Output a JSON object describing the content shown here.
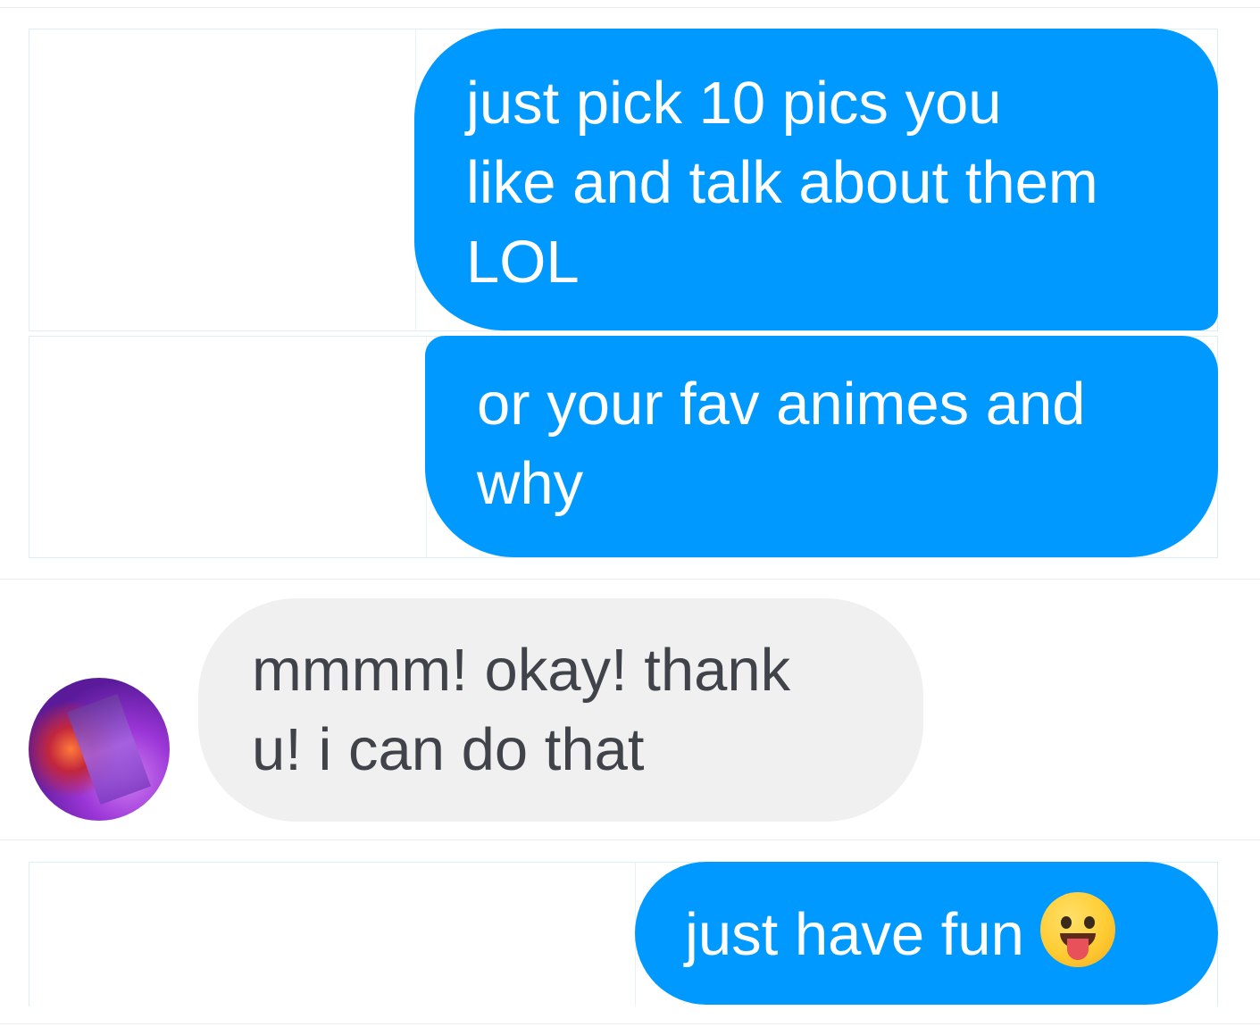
{
  "conversation": {
    "messages": [
      {
        "direction": "outgoing",
        "lines": [
          "just pick 10 pics you",
          "like and talk about them",
          "LOL"
        ]
      },
      {
        "direction": "outgoing",
        "lines": [
          "or your fav animes and",
          "why"
        ]
      },
      {
        "direction": "incoming",
        "lines": [
          "mmmm! okay! thank",
          "u! i can do that"
        ],
        "avatar_icon": "user-avatar"
      },
      {
        "direction": "outgoing",
        "lines": [
          "just have fun"
        ],
        "emoji": "face-with-tongue-icon"
      }
    ]
  },
  "colors": {
    "outgoing_bubble": "#0099ff",
    "outgoing_text": "#ffffff",
    "incoming_bubble": "#f0f0f0",
    "incoming_text": "#404349",
    "divider": "#e6eef3"
  }
}
